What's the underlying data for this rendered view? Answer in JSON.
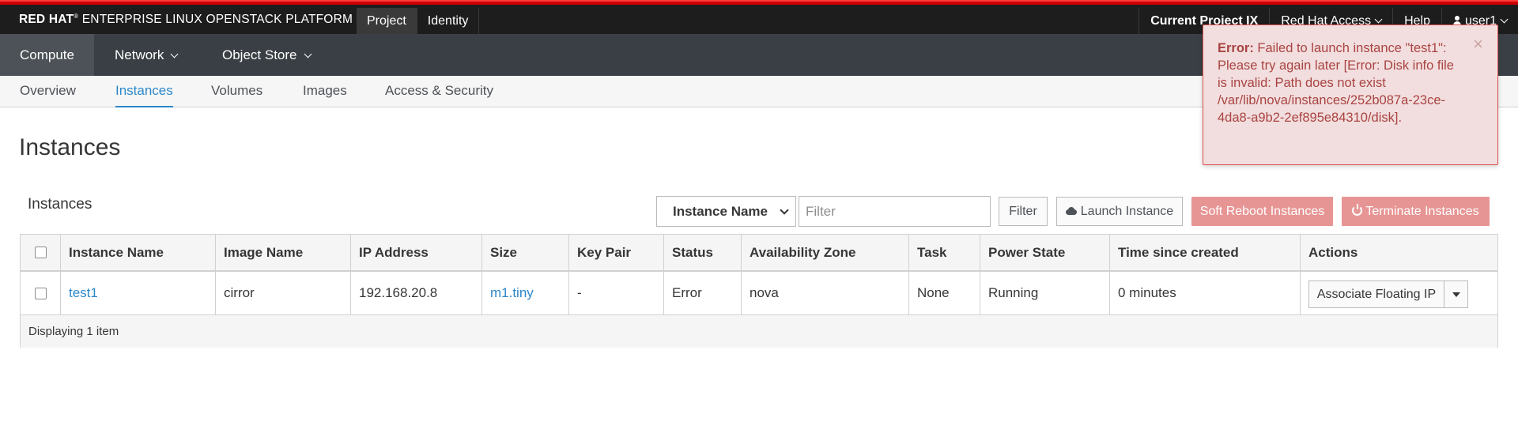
{
  "brand": {
    "prefix": "RED HAT",
    "reg": "®",
    "name": " ENTERPRISE LINUX OPENSTACK PLATFORM"
  },
  "topnav": {
    "project": "Project",
    "identity": "Identity"
  },
  "topright": {
    "current_project": "Current Project IX",
    "red_hat_access": "Red Hat Access",
    "help": "Help",
    "user": "user1"
  },
  "secondary_nav": {
    "compute": "Compute",
    "network": "Network",
    "object_store": "Object Store"
  },
  "tabs": {
    "overview": "Overview",
    "instances": "Instances",
    "volumes": "Volumes",
    "images": "Images",
    "access_security": "Access & Security"
  },
  "page": {
    "title": "Instances",
    "caption": "Instances"
  },
  "toolbar": {
    "filter_field": "Instance Name",
    "filter_placeholder": "Filter",
    "filter_button": "Filter",
    "launch_button": "Launch Instance",
    "soft_reboot_button": "Soft Reboot Instances",
    "terminate_button": "Terminate Instances"
  },
  "table": {
    "headers": [
      "Instance Name",
      "Image Name",
      "IP Address",
      "Size",
      "Key Pair",
      "Status",
      "Availability Zone",
      "Task",
      "Power State",
      "Time since created",
      "Actions"
    ],
    "rows": [
      {
        "instance_name": "test1",
        "image_name": "cirror",
        "ip_address": "192.168.20.8",
        "size": "m1.tiny",
        "key_pair": "-",
        "status": "Error",
        "availability_zone": "nova",
        "task": "None",
        "power_state": "Running",
        "time_since_created": "0 minutes",
        "action": "Associate Floating IP"
      }
    ],
    "footer": "Displaying 1 item"
  },
  "toast": {
    "label": "Error:",
    "message": " Failed to launch instance \"test1\": Please try again later [Error: Disk info file is invalid: Path does not exist /var/lib/nova/instances/252b087a-23ce-4da8-a9b2-2ef895e84310/disk].",
    "close": "×"
  }
}
